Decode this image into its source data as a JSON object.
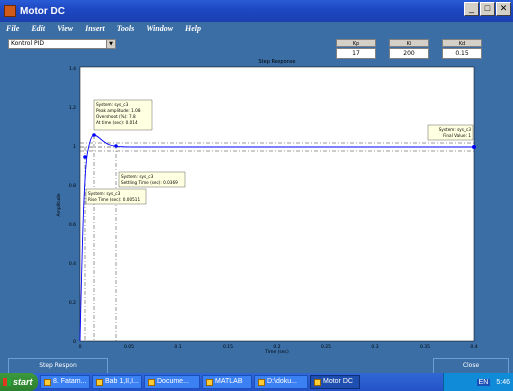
{
  "window": {
    "title": "Motor DC",
    "min_label": "_",
    "close_label": "✕"
  },
  "menu": [
    "File",
    "Edit",
    "View",
    "Insert",
    "Tools",
    "Window",
    "Help"
  ],
  "controller": {
    "selected": "Kontrol PID"
  },
  "gains": [
    {
      "label": "Kp",
      "value": "17"
    },
    {
      "label": "Ki",
      "value": "200"
    },
    {
      "label": "Kd",
      "value": "0.15"
    }
  ],
  "plot": {
    "title": "Step Response",
    "ylabel": "Amplitude",
    "xlabel": "Time (sec)",
    "yticks": [
      "1.2",
      "1",
      "0.8",
      "0.6",
      "0.4",
      "0.2",
      "0"
    ],
    "xticks": [
      "0",
      "0.05",
      "0.1",
      "0.15",
      "0.2",
      "0.25",
      "0.3",
      "0.35",
      "0.4"
    ],
    "top_tick": "1.4",
    "annotations": {
      "peak": [
        "System: sys_c3",
        "Peak amplitude: 1.08",
        "Overshoot (%): 7.8",
        "At time (sec): 0.014"
      ],
      "settling": [
        "System: sys_c3",
        "Settling Time (sec): 0.0369"
      ],
      "rise": [
        "System: sys_c3",
        "Rise Time (sec): 0.00511"
      ],
      "final": [
        "System: sys_c3",
        "Final Value: 1"
      ]
    }
  },
  "buttons": {
    "step": "Step Respon",
    "close": "Close"
  },
  "taskbar": {
    "start": "start",
    "tasks": [
      "8. Fatam...",
      "Bab 1,II,I...",
      "Docume...",
      "MATLAB",
      "D:\\doku...",
      "Motor DC"
    ],
    "tray_lang": "EN",
    "clock": "5:46"
  },
  "colors": {
    "bg": "#3a6ea5",
    "line": "#0000ff",
    "titlebar": "#1e48c3"
  }
}
